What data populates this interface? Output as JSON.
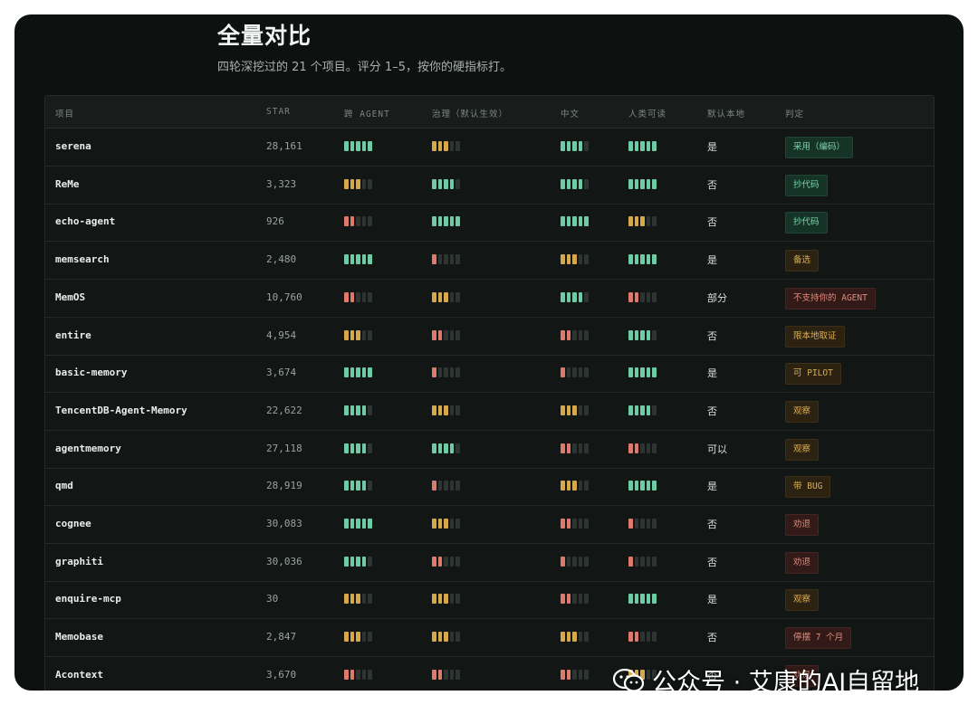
{
  "header": {
    "title": "全量对比",
    "subtitle": "四轮深挖过的 21 个项目。评分 1–5，按你的硬指标打。"
  },
  "columns": [
    "项目",
    "STAR",
    "跨 AGENT",
    "治理（默认生效）",
    "中文",
    "人类可读",
    "默认本地",
    "判定"
  ],
  "colors": {
    "high": "#6fcba6",
    "mid": "#d7a849",
    "low": "#dd7a6b",
    "empty": "#2e3432"
  },
  "rows": [
    {
      "name": "serena",
      "star": "28,161",
      "agent": 5,
      "gov": 3,
      "zh": 4,
      "read": 5,
      "local": "是",
      "verdict": "采用（编码）",
      "tone": "green"
    },
    {
      "name": "ReMe",
      "star": "3,323",
      "agent": 3,
      "gov": 4,
      "zh": 4,
      "read": 5,
      "local": "否",
      "verdict": "抄代码",
      "tone": "green"
    },
    {
      "name": "echo-agent",
      "star": "926",
      "agent": 2,
      "gov": 5,
      "zh": 5,
      "read": 3,
      "local": "否",
      "verdict": "抄代码",
      "tone": "green"
    },
    {
      "name": "memsearch",
      "star": "2,480",
      "agent": 5,
      "gov": 1,
      "zh": 3,
      "read": 5,
      "local": "是",
      "verdict": "备选",
      "tone": "amber"
    },
    {
      "name": "MemOS",
      "star": "10,760",
      "agent": 2,
      "gov": 3,
      "zh": 4,
      "read": 2,
      "local": "部分",
      "verdict": "不支持你的 AGENT",
      "tone": "red"
    },
    {
      "name": "entire",
      "star": "4,954",
      "agent": 3,
      "gov": 2,
      "zh": 2,
      "read": 4,
      "local": "否",
      "verdict": "限本地取证",
      "tone": "amber"
    },
    {
      "name": "basic-memory",
      "star": "3,674",
      "agent": 5,
      "gov": 1,
      "zh": 1,
      "read": 5,
      "local": "是",
      "verdict": "可 PILOT",
      "tone": "amber"
    },
    {
      "name": "TencentDB-Agent-Memory",
      "star": "22,622",
      "agent": 4,
      "gov": 3,
      "zh": 3,
      "read": 4,
      "local": "否",
      "verdict": "观察",
      "tone": "amber"
    },
    {
      "name": "agentmemory",
      "star": "27,118",
      "agent": 4,
      "gov": 4,
      "zh": 2,
      "read": 2,
      "local": "可以",
      "verdict": "观察",
      "tone": "amber"
    },
    {
      "name": "qmd",
      "star": "28,919",
      "agent": 4,
      "gov": 1,
      "zh": 3,
      "read": 5,
      "local": "是",
      "verdict": "带 BUG",
      "tone": "amber"
    },
    {
      "name": "cognee",
      "star": "30,083",
      "agent": 5,
      "gov": 3,
      "zh": 2,
      "read": 1,
      "local": "否",
      "verdict": "劝退",
      "tone": "red"
    },
    {
      "name": "graphiti",
      "star": "30,036",
      "agent": 4,
      "gov": 2,
      "zh": 1,
      "read": 1,
      "local": "否",
      "verdict": "劝退",
      "tone": "red"
    },
    {
      "name": "enquire-mcp",
      "star": "30",
      "agent": 3,
      "gov": 3,
      "zh": 2,
      "read": 5,
      "local": "是",
      "verdict": "观察",
      "tone": "amber"
    },
    {
      "name": "Memobase",
      "star": "2,847",
      "agent": 3,
      "gov": 3,
      "zh": 3,
      "read": 2,
      "local": "否",
      "verdict": "停摆 7 个月",
      "tone": "red"
    },
    {
      "name": "Acontext",
      "star": "3,670",
      "agent": 2,
      "gov": 2,
      "zh": 2,
      "read": 3,
      "local": "否",
      "verdict": "劝退",
      "tone": "red"
    }
  ],
  "watermark": {
    "text": "公众号 · 艾康的AI自留地",
    "icon": "wechat-icon"
  }
}
